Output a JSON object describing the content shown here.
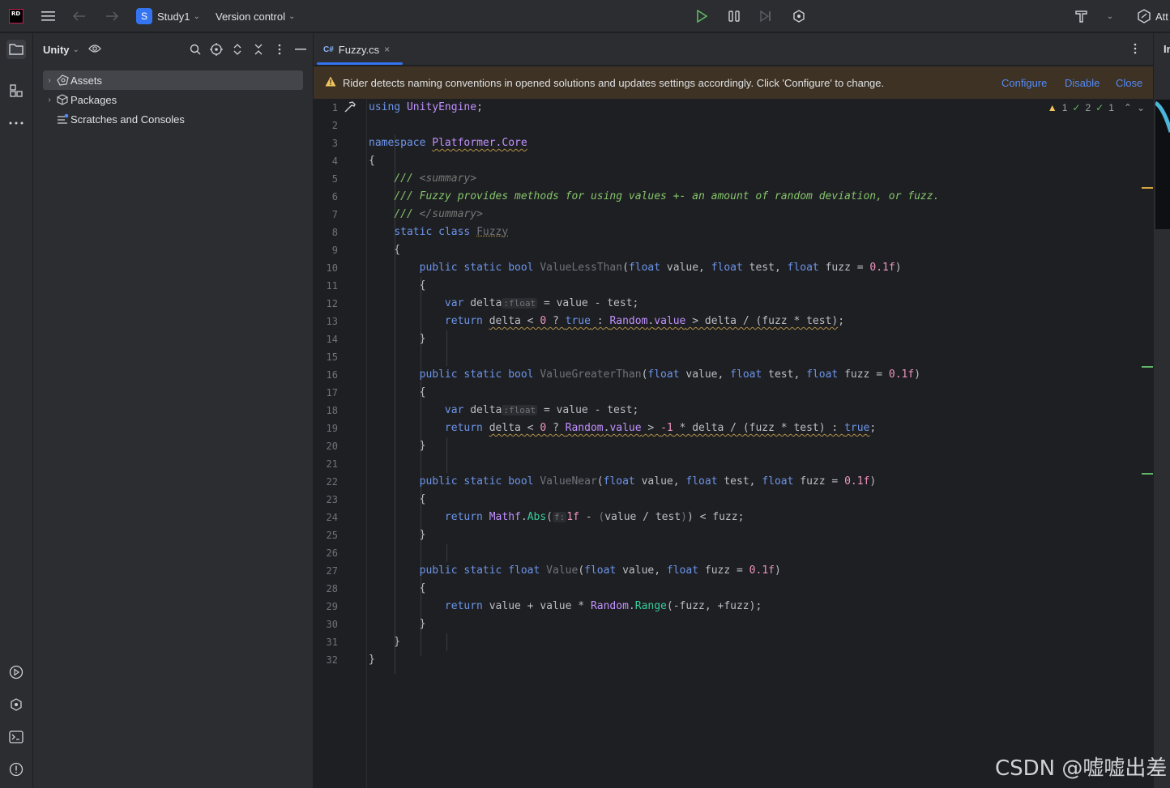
{
  "titlebar": {
    "app_logo": "RD",
    "project_initial": "S",
    "project_name": "Study1",
    "vcs_label": "Version control",
    "attach_label": "Att",
    "right_edge_label": "In"
  },
  "project_panel": {
    "title": "Unity",
    "tree": [
      {
        "label": "Assets",
        "selected": true
      },
      {
        "label": "Packages",
        "selected": false
      },
      {
        "label": "Scratches and Consoles",
        "selected": false
      }
    ]
  },
  "editor": {
    "tab": {
      "lang_badge": "C#",
      "label": "Fuzzy.cs",
      "close": "×"
    },
    "banner": {
      "text": "Rider detects naming conventions in opened solutions and updates settings accordingly. Click 'Configure' to change.",
      "configure": "Configure",
      "disable": "Disable",
      "close": "Close"
    },
    "inspection": {
      "warnings": "1",
      "ok": "2",
      "typos": "1"
    },
    "line_numbers": [
      "1",
      "2",
      "3",
      "4",
      "5",
      "6",
      "7",
      "8",
      "9",
      "10",
      "11",
      "12",
      "13",
      "14",
      "15",
      "16",
      "17",
      "18",
      "19",
      "20",
      "21",
      "22",
      "23",
      "24",
      "25",
      "26",
      "27",
      "28",
      "29",
      "30",
      "31",
      "32"
    ],
    "inlay_float": ":float",
    "inlay_f": "f:"
  },
  "watermark": "CSDN @嘘嘘出差",
  "colors": {
    "accent": "#3574f0",
    "banner_bg": "#3d3223",
    "keyword": "#6c95eb",
    "namespace": "#c191ff",
    "comment": "#85c46c",
    "number": "#ed94c0",
    "method": "#39cc9b"
  }
}
